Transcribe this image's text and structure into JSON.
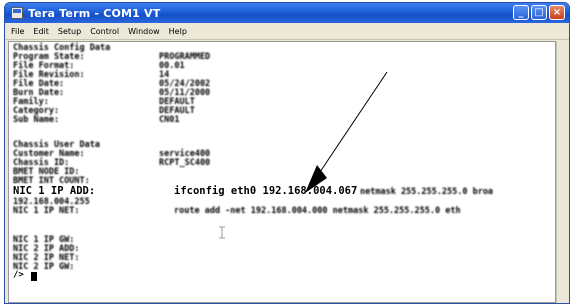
{
  "window": {
    "title": "Tera Term - COM1 VT"
  },
  "menu": [
    "File",
    "Edit",
    "Setup",
    "Control",
    "Window",
    "Help"
  ],
  "terminal": {
    "config_heading": "Chassis Config Data",
    "config_rows": [
      {
        "label": "Program State:",
        "value": "PROGRAMMED"
      },
      {
        "label": "File Format:",
        "value": "00.01"
      },
      {
        "label": "File Revision:",
        "value": "14"
      },
      {
        "label": "File Date:",
        "value": "05/24/2002"
      },
      {
        "label": "Burn Date:",
        "value": "05/11/2000"
      },
      {
        "label": "Family:",
        "value": "DEFAULT"
      },
      {
        "label": "Category:",
        "value": "DEFAULT"
      },
      {
        "label": "Sub Name:",
        "value": "CN01"
      }
    ],
    "user_heading": "Chassis User Data",
    "user_rows": [
      {
        "label": "Customer Name:",
        "value": "service400"
      },
      {
        "label": "Chassis ID:",
        "value": "RCPT_SC400"
      },
      {
        "label": "BMET NODE ID:",
        "value": ""
      },
      {
        "label": "BMET INT COUNT:",
        "value": ""
      }
    ],
    "nic_ip_add_label": "NIC 1 IP ADD:",
    "nic_ip_add_value": "192.168.004.255",
    "nic_net_label": "NIC 1 IP NET:",
    "ifconfig_prefix": "ifconfig eth0 192.168.004.067",
    "ifconfig_suffix": "netmask 255.255.255.0 broa",
    "route_cmd": "route add -net 192.168.004.000 netmask 255.255.255.0 eth",
    "more_rows": [
      "NIC 1 IP GW:",
      "NIC 2 IP ADD:",
      "NIC 2 IP NET:",
      "NIC 2 IP GW:"
    ],
    "prompt": "/>"
  },
  "colors": {
    "titlebar": "#1c5fd8",
    "close": "#c8401e",
    "terminal_bg": "#ffffff",
    "text": "#000000"
  }
}
